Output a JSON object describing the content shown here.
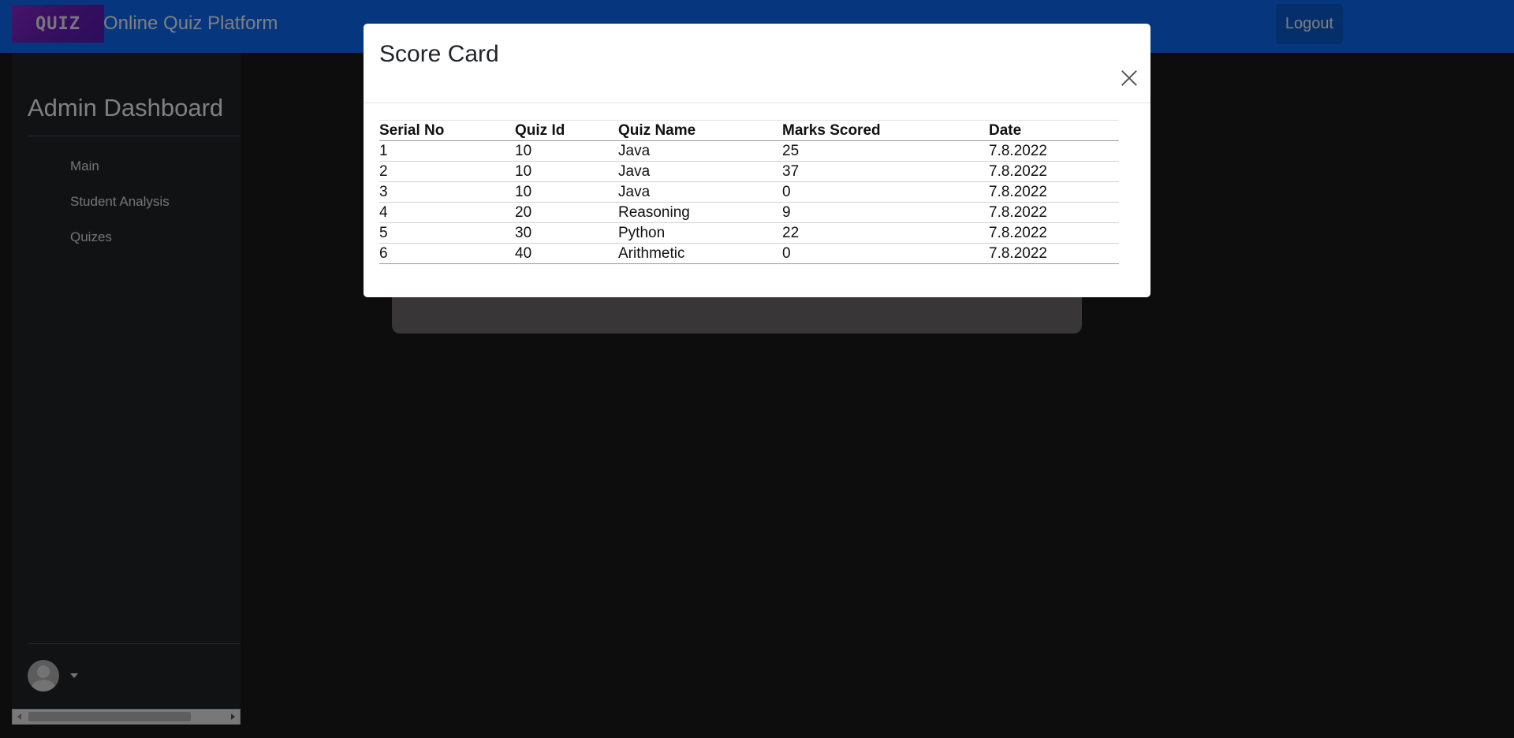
{
  "header": {
    "logo_text": "QUIZ",
    "brand": "Online Quiz Platform",
    "logout_label": "Logout"
  },
  "sidebar": {
    "title": "Admin Dashboard",
    "items": [
      {
        "label": "Main"
      },
      {
        "label": "Student Analysis"
      },
      {
        "label": "Quizes"
      }
    ]
  },
  "modal": {
    "title": "Score Card",
    "columns": [
      "Serial No",
      "Quiz Id",
      "Quiz Name",
      "Marks Scored",
      "Date"
    ],
    "rows": [
      [
        "1",
        "10",
        "Java",
        "25",
        "7.8.2022"
      ],
      [
        "2",
        "10",
        "Java",
        "37",
        "7.8.2022"
      ],
      [
        "3",
        "10",
        "Java",
        "0",
        "7.8.2022"
      ],
      [
        "4",
        "20",
        "Reasoning",
        "9",
        "7.8.2022"
      ],
      [
        "5",
        "30",
        "Python",
        "22",
        "7.8.2022"
      ],
      [
        "6",
        "40",
        "Arithmetic",
        "0",
        "7.8.2022"
      ]
    ]
  },
  "colors": {
    "topbar": "#0d6efd",
    "sidebar": "#212529",
    "logo": "#8c2bd8",
    "modal_bg": "#ffffff"
  },
  "icons": [
    "close-icon",
    "avatar-icon",
    "caret-down-icon",
    "scroll-left-icon",
    "scroll-right-icon"
  ]
}
